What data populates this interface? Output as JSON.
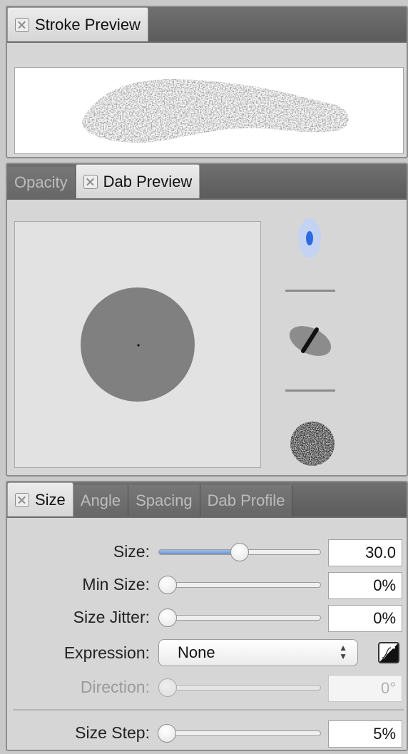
{
  "stroke_panel": {
    "tab": "Stroke Preview"
  },
  "dab_panel": {
    "tabs": [
      "Opacity",
      "Dab Preview"
    ]
  },
  "size_panel": {
    "tabs": [
      "Size",
      "Angle",
      "Spacing",
      "Dab Profile"
    ],
    "rows": {
      "size": {
        "label": "Size:",
        "value": "30.0",
        "slider_fraction": 0.5
      },
      "min_size": {
        "label": "Min Size:",
        "value": "0%",
        "slider_fraction": 0.0
      },
      "size_jitter": {
        "label": "Size Jitter:",
        "value": "0%",
        "slider_fraction": 0.0
      },
      "expression": {
        "label": "Expression:",
        "value": "None"
      },
      "direction": {
        "label": "Direction:",
        "value": "0°",
        "slider_fraction": 0.0,
        "disabled": true
      },
      "size_step": {
        "label": "Size Step:",
        "value": "5%",
        "slider_fraction": 0.05
      }
    }
  },
  "colors": {
    "accent": "#6c93cf",
    "dab_fill": "#808080",
    "tab_bar": "#646464"
  }
}
